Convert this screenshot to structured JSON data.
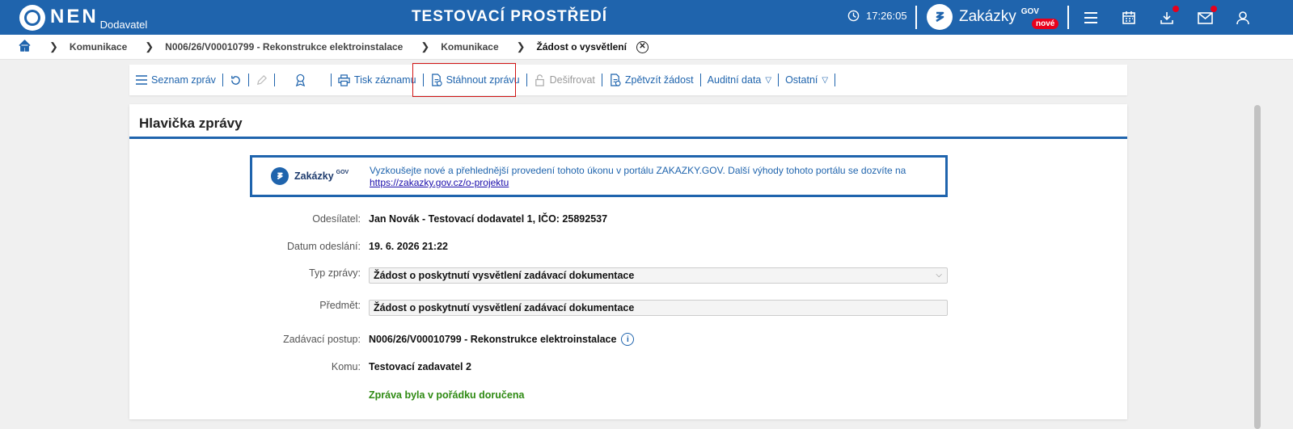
{
  "topbar": {
    "logo_text": "NEN",
    "logo_sub": "Dodavatel",
    "environment": "TESTOVACÍ PROSTŘEDÍ",
    "time": "17:26:05",
    "zakazky": "Zakázky",
    "zakazky_gov": "GOV",
    "zakazky_badge": "nové",
    "accent_color": "#1f64ad",
    "badge_color": "#e8001c"
  },
  "breadcrumb": {
    "items": [
      "Komunikace",
      "N006/26/V00010799 - Rekonstrukce elektroinstalace",
      "Komunikace",
      "Žádost o vysvětlení"
    ]
  },
  "toolbar": {
    "seznam": "Seznam zpráv",
    "tisk": "Tisk záznamu",
    "stahnout": "Stáhnout zprávu",
    "desifrovat": "Dešifrovat",
    "zpetvzit": "Zpětvzít žádost",
    "auditni": "Auditní data",
    "ostatni": "Ostatní"
  },
  "panel": {
    "title": "Hlavička zprávy",
    "promo": {
      "name": "Zakázky",
      "gov": "GOV",
      "text": "Vyzkoušejte nové a přehlednější provedení tohoto úkonu v portálu ZAKAZKY.GOV. Další výhody tohoto portálu se dozvíte na",
      "link": "https://zakazky.gov.cz/o-projektu"
    },
    "odesilatel_label": "Odesílatel:",
    "odesilatel": "Jan Novák - Testovací dodavatel 1, IČO: 25892537",
    "datum_label": "Datum odeslání:",
    "datum": "19. 6. 2026 21:22",
    "typ_label": "Typ zprávy:",
    "typ": "Žádost o poskytnutí vysvětlení zadávací dokumentace",
    "predmet_label": "Předmět:",
    "predmet": "Žádost o poskytnutí vysvětlení zadávací dokumentace",
    "postup_label": "Zadávací postup:",
    "postup": "N006/26/V00010799 - Rekonstrukce elektroinstalace",
    "komu_label": "Komu:",
    "komu": "Testovací zadavatel 2",
    "status": "Zpráva byla v pořádku doručena",
    "status_color": "#2e8a12"
  }
}
